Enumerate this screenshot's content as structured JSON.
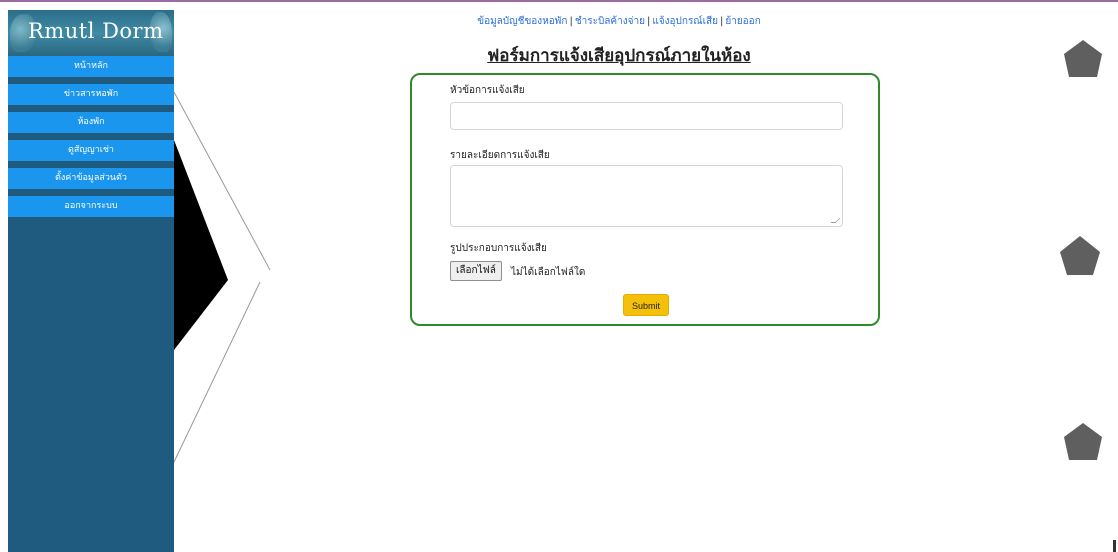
{
  "brand": {
    "logo_text": "Rmutl Dorm"
  },
  "sidebar": {
    "items": [
      {
        "label": "หน้าหลัก"
      },
      {
        "label": "ข่าวสารหอพัก"
      },
      {
        "label": "ห้องพัก"
      },
      {
        "label": "ดูสัญญาเช่า"
      },
      {
        "label": "ตั้งค่าข้อมูลส่วนตัว"
      },
      {
        "label": "ออกจากระบบ"
      }
    ]
  },
  "topnav": {
    "links": [
      {
        "label": "ข้อมูลบัญชีของหอพัก"
      },
      {
        "label": "ชำระบิลค้างจ่าย"
      },
      {
        "label": "แจ้งอุปกรณ์เสีย"
      },
      {
        "label": "ย้ายออก"
      }
    ],
    "separator": "|"
  },
  "form": {
    "title": "ฟอร์มการแจ้งเสียอุปกรณ์ภายในห้อง",
    "subject_label": "หัวข้อการแจ้งเสีย",
    "subject_value": "",
    "detail_label": "รายละเอียดการแจ้งเสีย",
    "detail_value": "",
    "image_label": "รูปประกอบการแจ้งเสีย",
    "file_button": "เลือกไฟล์",
    "file_status": "ไม่ได้เลือกไฟล์ใด",
    "submit_label": "Submit"
  },
  "colors": {
    "sidebar_bg": "#1e5b7f",
    "menu_item_bg": "#1a96ef",
    "form_border": "#2f8a2c",
    "submit_bg": "#f5c009",
    "link": "#2a6fd6"
  }
}
